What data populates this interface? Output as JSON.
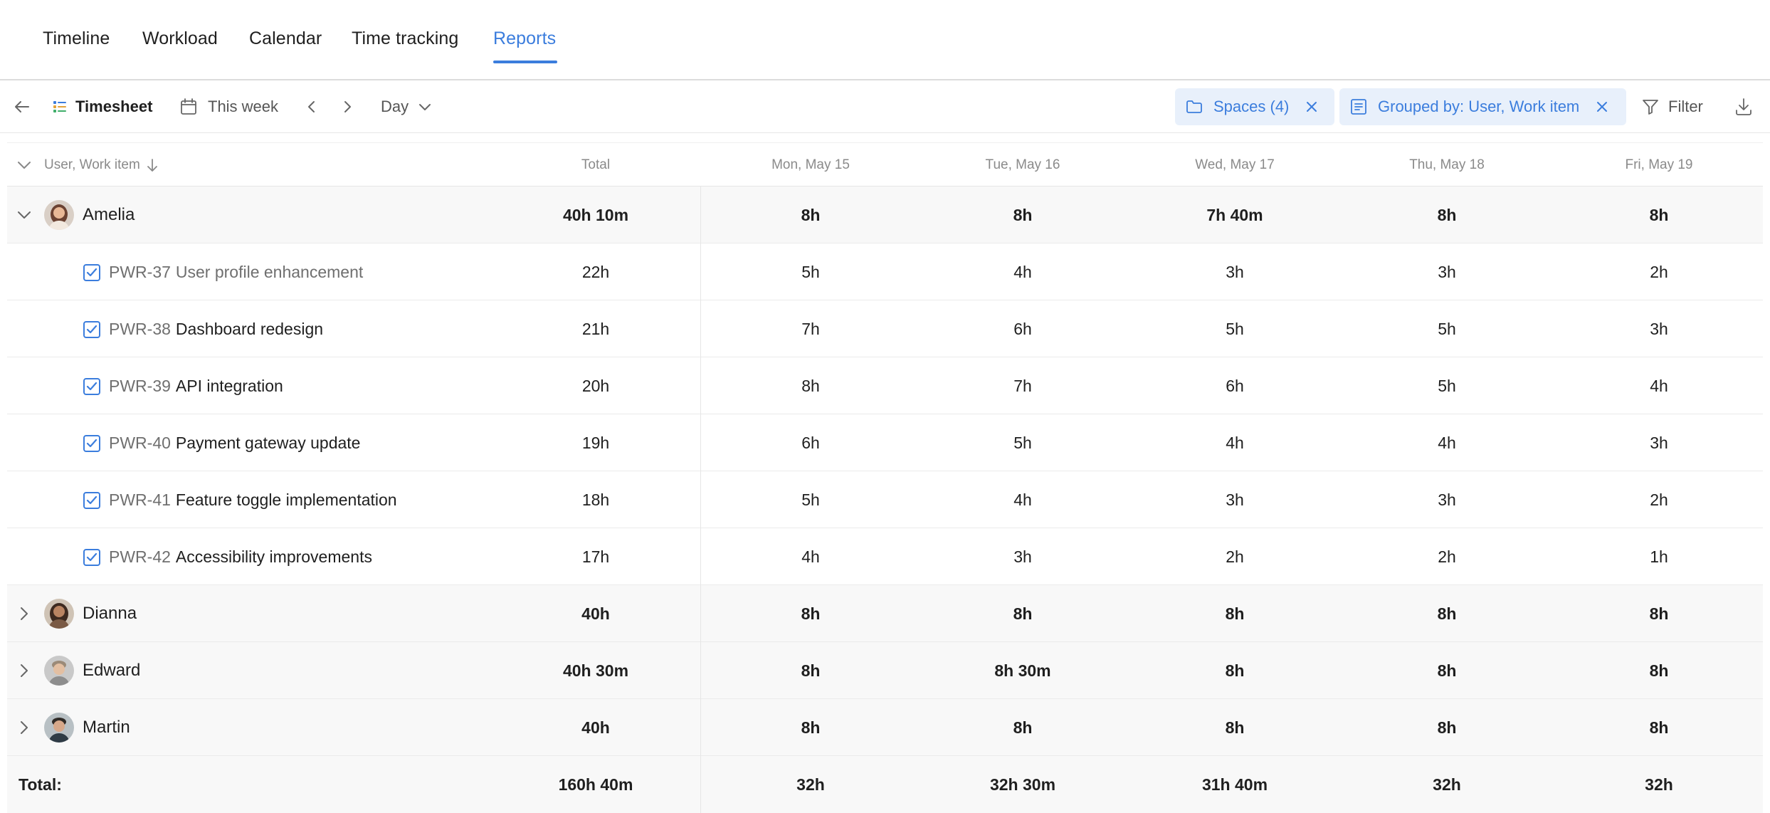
{
  "nav": {
    "tabs": [
      {
        "label": "Timeline"
      },
      {
        "label": "Workload"
      },
      {
        "label": "Calendar"
      },
      {
        "label": "Time tracking"
      },
      {
        "label": "Reports"
      }
    ],
    "active_tab": "Reports"
  },
  "toolbar": {
    "report_name": "Timesheet",
    "date_range": "This week",
    "granularity": "Day",
    "spaces_chip": "Spaces (4)",
    "grouping_chip": "Grouped by: User, Work item",
    "filter_label": "Filter"
  },
  "table": {
    "headers": {
      "name": "User, Work item",
      "total": "Total",
      "days": [
        "Mon, May 15",
        "Tue, May 16",
        "Wed, May 17",
        "Thu, May 18",
        "Fri, May 19"
      ]
    },
    "users": [
      {
        "name": "Amelia",
        "total": "40h 10m",
        "days": [
          "8h",
          "8h",
          "7h 40m",
          "8h",
          "8h"
        ],
        "expanded": true
      },
      {
        "name": "Dianna",
        "total": "40h",
        "days": [
          "8h",
          "8h",
          "8h",
          "8h",
          "8h"
        ],
        "expanded": false
      },
      {
        "name": "Edward",
        "total": "40h 30m",
        "days": [
          "8h",
          "8h 30m",
          "8h",
          "8h",
          "8h"
        ],
        "expanded": false
      },
      {
        "name": "Martin",
        "total": "40h",
        "days": [
          "8h",
          "8h",
          "8h",
          "8h",
          "8h"
        ],
        "expanded": false
      }
    ],
    "work_items": [
      {
        "key": "PWR-37",
        "title": "User profile enhancement",
        "total": "22h",
        "days": [
          "5h",
          "4h",
          "3h",
          "3h",
          "2h"
        ]
      },
      {
        "key": "PWR-38",
        "title": "Dashboard redesign",
        "total": "21h",
        "days": [
          "7h",
          "6h",
          "5h",
          "5h",
          "3h"
        ]
      },
      {
        "key": "PWR-39",
        "title": "API integration",
        "total": "20h",
        "days": [
          "8h",
          "7h",
          "6h",
          "5h",
          "4h"
        ]
      },
      {
        "key": "PWR-40",
        "title": "Payment gateway update",
        "total": "19h",
        "days": [
          "6h",
          "5h",
          "4h",
          "4h",
          "3h"
        ]
      },
      {
        "key": "PWR-41",
        "title": "Feature toggle implementation",
        "total": "18h",
        "days": [
          "5h",
          "4h",
          "3h",
          "3h",
          "2h"
        ]
      },
      {
        "key": "PWR-42",
        "title": "Accessibility improvements",
        "total": "17h",
        "days": [
          "4h",
          "3h",
          "2h",
          "2h",
          "1h"
        ]
      }
    ],
    "totals": {
      "label": "Total:",
      "total": "160h 40m",
      "days": [
        "32h",
        "32h 30m",
        "31h 40m",
        "32h",
        "32h"
      ]
    }
  },
  "colors": {
    "accent": "#3b7ddd",
    "chip_bg": "#e8f0fb",
    "group_row_bg": "#f8f8f8"
  }
}
